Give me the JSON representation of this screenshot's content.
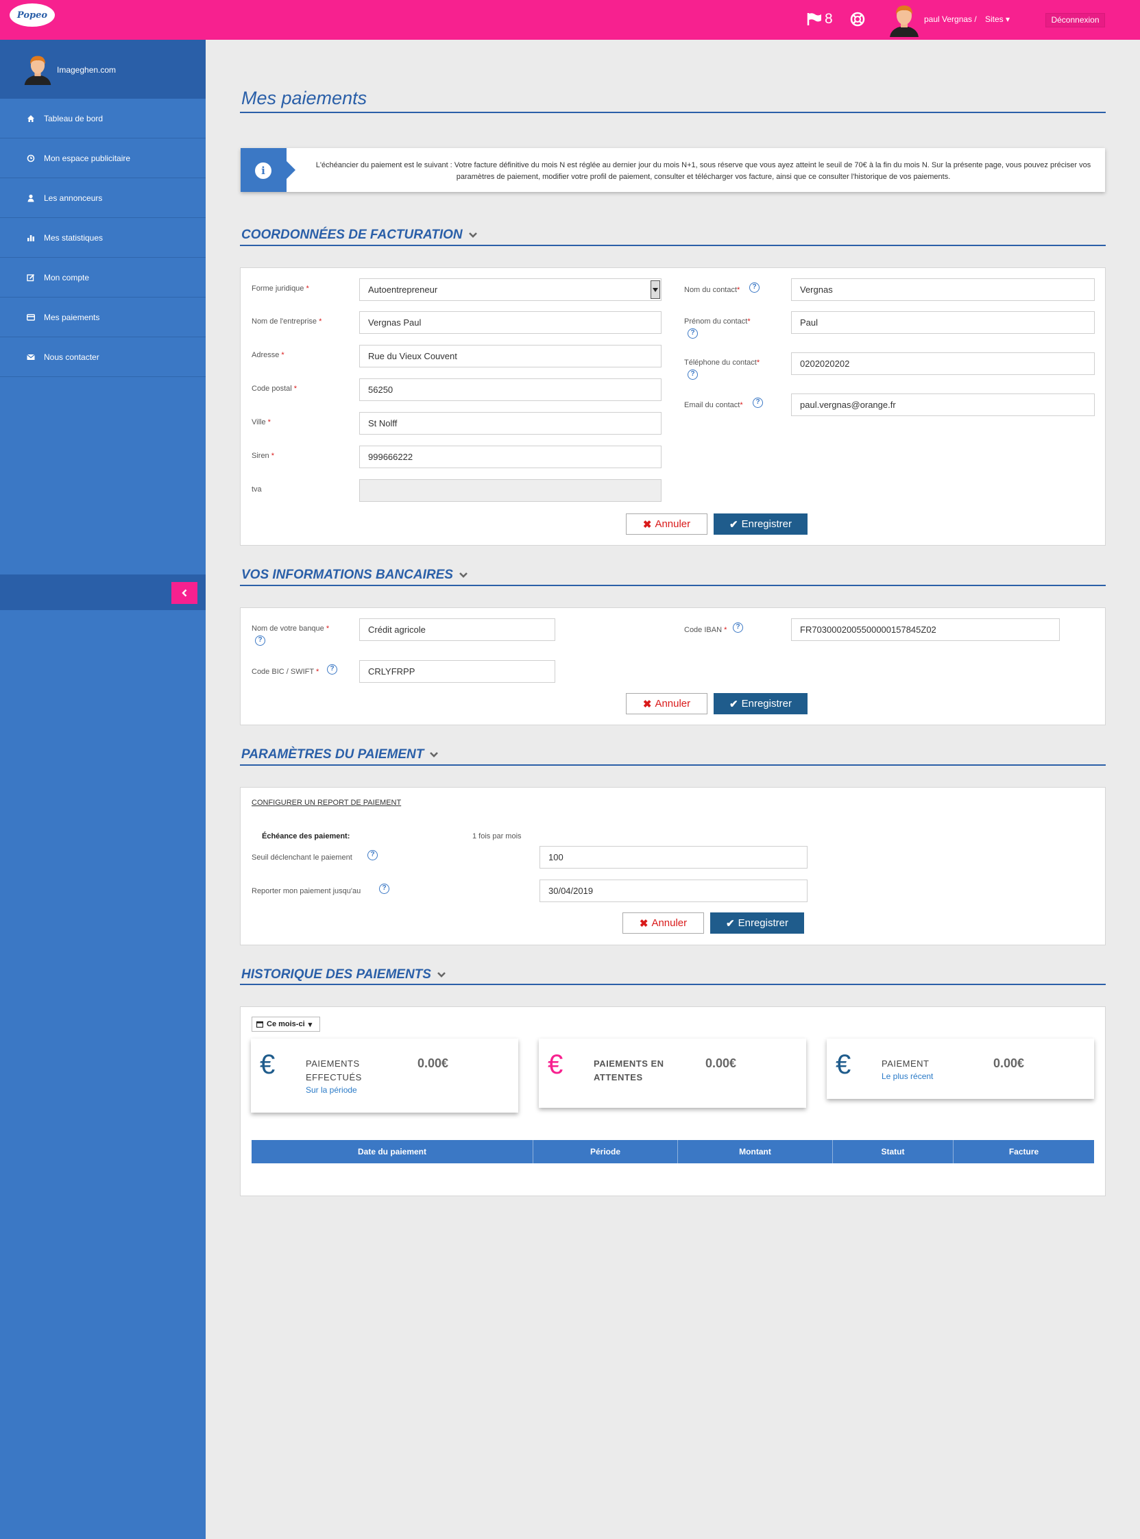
{
  "topbar": {
    "logo_text": "Popeo",
    "notifications_count": "8",
    "user_label": "paul Vergnas /",
    "sites_label": "Sites",
    "logout_label": "Déconnexion",
    "accent_color": "#f7218f"
  },
  "sidebar": {
    "site_name": "Imageghen.com",
    "items": [
      {
        "label": "Tableau de bord",
        "icon": "home-icon"
      },
      {
        "label": "Mon espace publicitaire",
        "icon": "clock-icon"
      },
      {
        "label": "Les annonceurs",
        "icon": "user-icon"
      },
      {
        "label": "Mes statistiques",
        "icon": "bar-chart-icon"
      },
      {
        "label": "Mon compte",
        "icon": "edit-icon"
      },
      {
        "label": "Mes paiements",
        "icon": "credit-card-icon"
      },
      {
        "label": "Nous contacter",
        "icon": "envelope-icon"
      }
    ]
  },
  "page": {
    "title": "Mes paiements",
    "info_text": "L'échéancier du paiement est le suivant : Votre facture définitive du mois N est réglée au dernier jour du mois N+1, sous réserve que vous ayez atteint le seuil de 70€ à la fin du mois N. Sur la présente page, vous pouvez préciser vos paramètres de paiement, modifier votre profil de paiement, consulter et télécharger vos facture, ainsi que ce consulter l'historique de vos paiements."
  },
  "billing": {
    "title": "COORDONNÉES DE FACTURATION",
    "forme_label": "Forme juridique",
    "forme_value": "Autoentrepreneur",
    "entreprise_label": "Nom de l'entreprise",
    "entreprise_value": "Vergnas Paul",
    "adresse_label": "Adresse",
    "adresse_value": "Rue du Vieux Couvent",
    "cp_label": "Code postal",
    "cp_value": "56250",
    "ville_label": "Ville",
    "ville_value": "St Nolff",
    "siren_label": "Siren",
    "siren_value": "999666222",
    "tva_label": "tva",
    "tva_value": "",
    "contact_nom_label": "Nom du contact",
    "contact_nom_value": "Vergnas",
    "contact_prenom_label": "Prénom du contact",
    "contact_prenom_value": "Paul",
    "contact_tel_label": "Téléphone du contact",
    "contact_tel_value": "0202020202",
    "contact_email_label": "Email du contact",
    "contact_email_value": "paul.vergnas@orange.fr",
    "cancel_label": "Annuler",
    "save_label": "Enregistrer"
  },
  "bank": {
    "title": "VOS INFORMATIONS BANCAIRES",
    "banque_label": "Nom de votre banque",
    "banque_value": "Crédit agricole",
    "iban_label": "Code IBAN",
    "iban_value": "FR7030002005500000157845Z02",
    "bic_label": "Code BIC / SWIFT",
    "bic_value": "CRLYFRPP",
    "cancel_label": "Annuler",
    "save_label": "Enregistrer"
  },
  "params": {
    "title": "PARAMÈTRES DU PAIEMENT",
    "configure_link": "CONFIGURER UN REPORT DE PAIEMENT",
    "echeance_label": "Échéance des paiement:",
    "echeance_value": "1 fois par mois",
    "seuil_label": "Seuil déclenchant le paiement",
    "seuil_value": "100",
    "report_label": "Reporter mon paiement jusqu'au",
    "report_value": "30/04/2019",
    "cancel_label": "Annuler",
    "save_label": "Enregistrer"
  },
  "history": {
    "title": "HISTORIQUE DES PAIEMENTS",
    "period_filter": "Ce mois-ci",
    "cards": [
      {
        "title_line1": "PAIEMENTS",
        "title_line2": "EFFECTUÉS",
        "subtitle": "Sur la période",
        "value": "0.00€",
        "color": "#1f5c8c"
      },
      {
        "title_line1": "PAIEMENTS EN",
        "title_line2": "ATTENTES",
        "subtitle": "",
        "value": "0.00€",
        "color": "#f7218f"
      },
      {
        "title_line1": "PAIEMENT",
        "title_line2": "",
        "subtitle": "Le plus récent",
        "value": "0.00€",
        "color": "#1f5c8c"
      }
    ],
    "columns": [
      "Date du paiement",
      "Période",
      "Montant",
      "Statut",
      "Facture"
    ]
  }
}
